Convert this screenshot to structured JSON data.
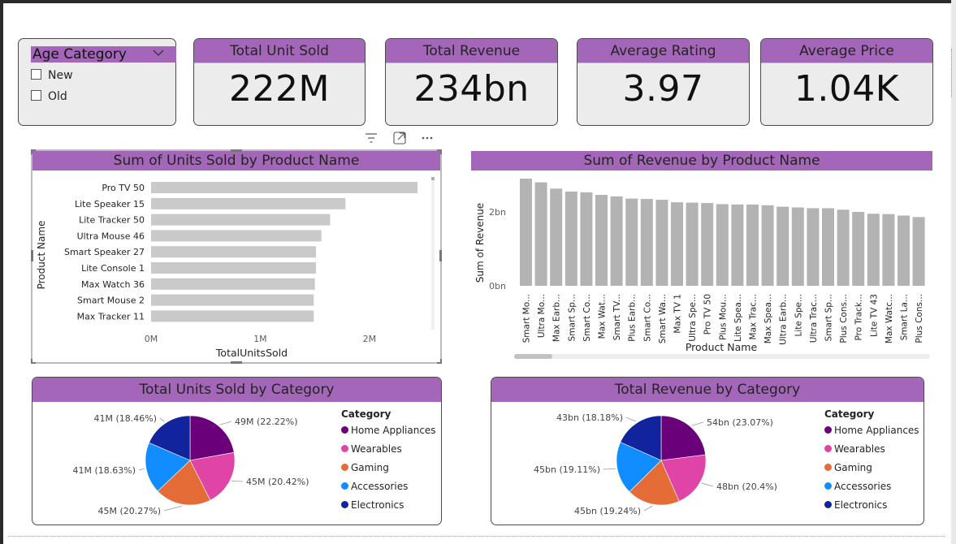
{
  "slicer": {
    "title": "Age Category",
    "options": [
      {
        "label": "New",
        "checked": false
      },
      {
        "label": "Old",
        "checked": false
      }
    ]
  },
  "kpis": [
    {
      "title": "Total Unit Sold",
      "value": "222M"
    },
    {
      "title": "Total Revenue",
      "value": "234bn"
    },
    {
      "title": "Average Rating",
      "value": "3.97"
    },
    {
      "title": "Average Price",
      "value": "1.04K"
    }
  ],
  "theme": {
    "header_purple": "#a366b8",
    "bar_gray": "#c9c9c9",
    "col_gray": "#b3b3b3",
    "card_bg": "#ececec"
  },
  "visual_header_icons": [
    "filter-icon",
    "focus-mode-icon",
    "more-options-icon"
  ],
  "chart_data": [
    {
      "type": "bar",
      "orientation": "horizontal",
      "title": "Sum of Units Sold by Product Name",
      "xlabel": "TotalUnitsSold",
      "ylabel": "Product Name",
      "categories": [
        "Pro TV 50",
        "Lite Speaker 15",
        "Lite Tracker 50",
        "Ultra Mouse 46",
        "Smart Speaker 27",
        "Lite Console 1",
        "Max Watch 36",
        "Smart Mouse 2",
        "Max Tracker 11"
      ],
      "values": [
        2440000,
        1780000,
        1640000,
        1560000,
        1510000,
        1510000,
        1500000,
        1490000,
        1490000
      ],
      "xlim": [
        0,
        2440000
      ],
      "xticks": [
        "0M",
        "1M",
        "2M"
      ],
      "xtick_values": [
        0,
        1000000,
        2000000
      ],
      "color": "#c9c9c9",
      "scrollbar": "vertical"
    },
    {
      "type": "bar",
      "orientation": "vertical",
      "title": "Sum of Revenue by Product Name",
      "xlabel": "Product Name",
      "ylabel": "Sum of Revenue",
      "categories": [
        "Smart Mo...",
        "Ultra Mo...",
        "Max Earb...",
        "Smart Sp...",
        "Smart Co...",
        "Max Wat...",
        "Smart TV...",
        "Plus Earb...",
        "Smart Co...",
        "Smart Wa...",
        "Max TV 1",
        "Ultra Spe...",
        "Pro TV 50",
        "Plus Mou...",
        "Lite Spea...",
        "Max Trac...",
        "Max Spea...",
        "Ultra Earb...",
        "Lite Spe...",
        "Ultra Trac...",
        "Smart Sp...",
        "Plus Cons...",
        "Pro Track...",
        "Lite TV 43",
        "Max Watc...",
        "Smart La...",
        "Plus Cons..."
      ],
      "values": [
        2.9,
        2.8,
        2.63,
        2.55,
        2.53,
        2.46,
        2.42,
        2.36,
        2.35,
        2.33,
        2.26,
        2.25,
        2.24,
        2.21,
        2.2,
        2.2,
        2.18,
        2.14,
        2.12,
        2.1,
        2.1,
        2.06,
        2.0,
        1.95,
        1.94,
        1.9,
        1.86
      ],
      "value_unit": "bn",
      "ylim": [
        0,
        2.9
      ],
      "yticks": [
        "0bn",
        "2bn"
      ],
      "ytick_values": [
        0,
        2
      ],
      "color": "#b3b3b3",
      "scrollbar": "horizontal"
    },
    {
      "type": "pie",
      "title": "Total Units Sold by Category",
      "legend_title": "Category",
      "legend_position": "right",
      "slices": [
        {
          "name": "Home Appliances",
          "value": 49,
          "label": "49M (22.22%)",
          "color": "#6b007b"
        },
        {
          "name": "Wearables",
          "value": 45,
          "label": "45M (20.42%)",
          "color": "#e044a7"
        },
        {
          "name": "Gaming",
          "value": 45,
          "label": "45M (20.27%)",
          "color": "#e66c37"
        },
        {
          "name": "Accessories",
          "value": 41,
          "label": "41M (18.63%)",
          "color": "#118dff"
        },
        {
          "name": "Electronics",
          "value": 41,
          "label": "41M (18.46%)",
          "color": "#12239e"
        }
      ]
    },
    {
      "type": "pie",
      "title": "Total Revenue by Category",
      "legend_title": "Category",
      "legend_position": "right",
      "slices": [
        {
          "name": "Home Appliances",
          "value": 54,
          "label": "54bn (23.07%)",
          "color": "#6b007b"
        },
        {
          "name": "Wearables",
          "value": 48,
          "label": "48bn (20.4%)",
          "color": "#e044a7"
        },
        {
          "name": "Gaming",
          "value": 45,
          "label": "45bn (19.24%)",
          "color": "#e66c37"
        },
        {
          "name": "Accessories",
          "value": 45,
          "label": "45bn (19.11%)",
          "color": "#118dff"
        },
        {
          "name": "Electronics",
          "value": 43,
          "label": "43bn (18.18%)",
          "color": "#12239e"
        }
      ]
    }
  ]
}
